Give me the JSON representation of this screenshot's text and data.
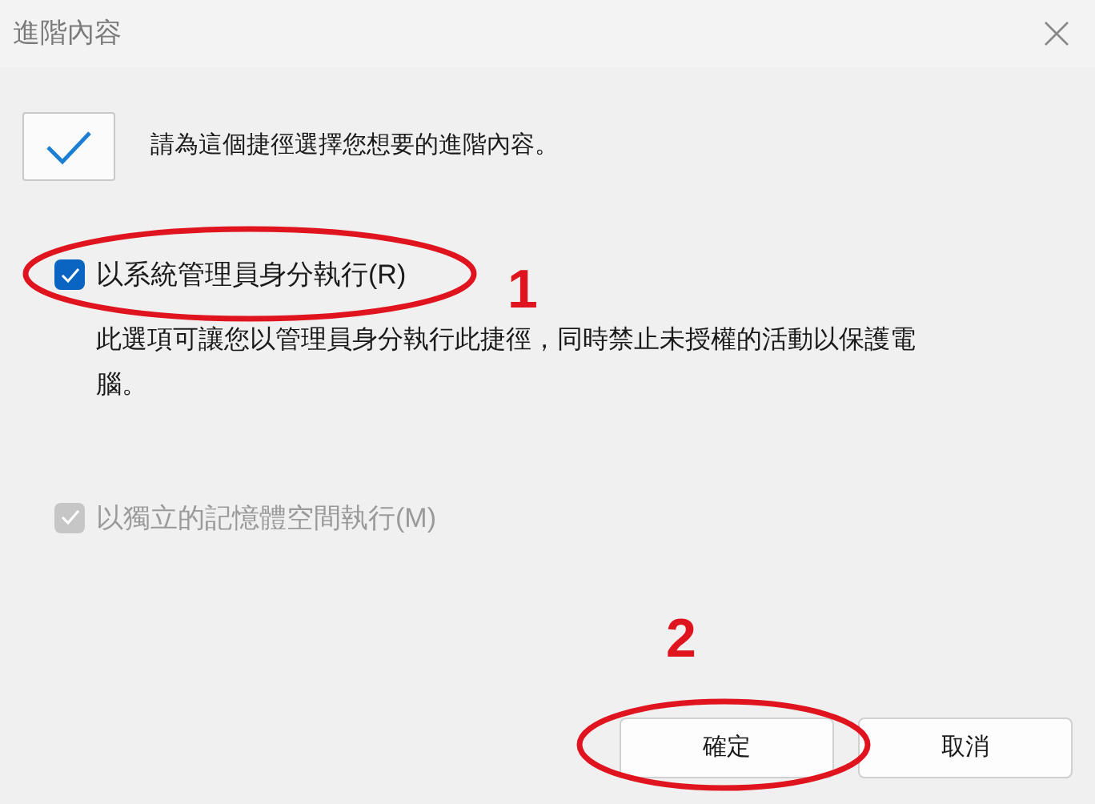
{
  "window": {
    "title": "進階內容"
  },
  "intro": {
    "text": "請為這個捷徑選擇您想要的進階內容。"
  },
  "options": [
    {
      "label": "以系統管理員身分執行(R)",
      "checked": true,
      "disabled": false,
      "description": "此選項可讓您以管理員身分執行此捷徑，同時禁止未授權的活動以保護電腦。"
    },
    {
      "label": "以獨立的記憶體空間執行(M)",
      "checked": true,
      "disabled": true
    }
  ],
  "buttons": [
    {
      "label": "確定"
    },
    {
      "label": "取消"
    }
  ],
  "annotations": [
    {
      "number": "1"
    },
    {
      "number": "2"
    }
  ]
}
